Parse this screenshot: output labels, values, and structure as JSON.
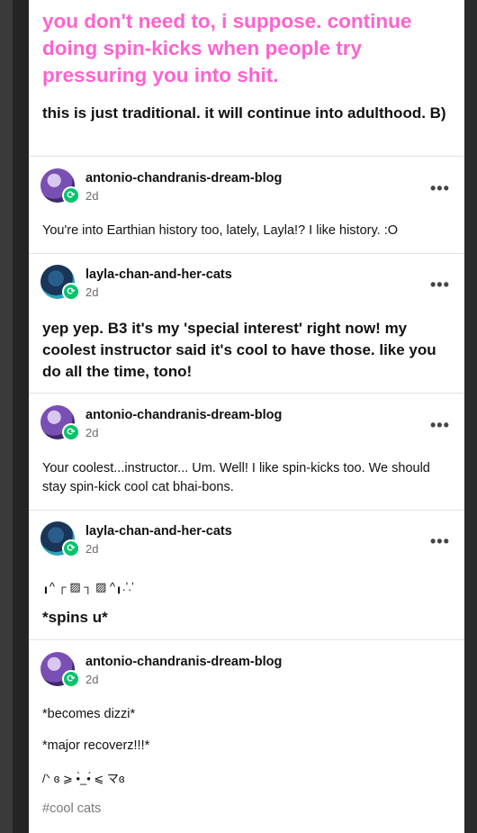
{
  "top": {
    "pink_text": "you don't need to, i suppose. continue doing spin-kicks when people try pressuring you into shit.",
    "bold_text": "this is just traditional. it will continue into adulthood. B)"
  },
  "posts": [
    {
      "username": "antonio-chandranis-dream-blog",
      "time": "2d",
      "body": "You're into Earthian history too, lately, Layla!? I like history.  :O",
      "more": "•••"
    },
    {
      "username": "layla-chan-and-her-cats",
      "time": "2d",
      "body": "yep yep. B3 it's my 'special interest' right now! my coolest instructor said it's cool to have those. like you do all the time, tono!",
      "more": "•••"
    },
    {
      "username": "antonio-chandranis-dream-blog",
      "time": "2d",
      "body": "Your coolest...instructor... Um. Well! I like spin-kicks too. We should stay spin-kick cool cat bhai-bons.",
      "more": "•••"
    },
    {
      "username": "layla-chan-and-her-cats",
      "time": "2d",
      "emote": "╻^ ┌ ▨  ┐ ▨ ^╻.ʼ.ʼ",
      "body": "*spins u*",
      "more": "•••"
    },
    {
      "username": "antonio-chandranis-dream-blog",
      "time": "2d",
      "lines": [
        "*becomes dizzi*",
        "*major recoverz!!!*",
        "/ᐠ ɞ ⩾ •̀_•́ ⩽ マɞ"
      ],
      "tag": "#cool cats"
    }
  ],
  "icons": {
    "reblog": "reblog-icon",
    "more": "more-options-icon"
  },
  "colors": {
    "pink": "#ff62ce",
    "badge_green": "#00c46a"
  }
}
